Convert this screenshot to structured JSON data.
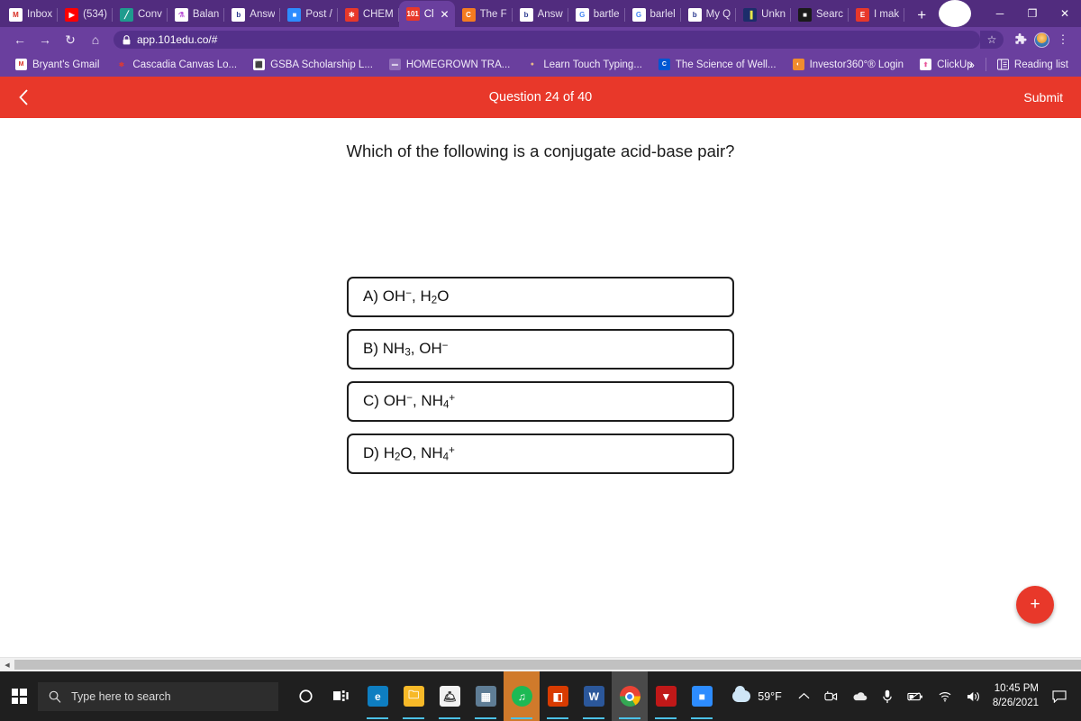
{
  "browser": {
    "tabs": [
      {
        "title": "Inbox",
        "favicon": "gmail-icon",
        "color": "#ffffff",
        "glyph": "M",
        "glyph_color": "#d93025",
        "active": false
      },
      {
        "title": "(534)",
        "favicon": "youtube-icon",
        "color": "#ff0000",
        "glyph": "▶",
        "glyph_color": "#ffffff",
        "active": false
      },
      {
        "title": "Conv",
        "favicon": "converter-icon",
        "color": "#1f9b8e",
        "glyph": "╱",
        "glyph_color": "#ffffff",
        "active": false
      },
      {
        "title": "Balan",
        "favicon": "flask-icon",
        "color": "#ffffff",
        "glyph": "⚗",
        "glyph_color": "#b84fd6",
        "active": false
      },
      {
        "title": "Answ",
        "favicon": "brainly-icon",
        "color": "#ffffff",
        "glyph": "b",
        "glyph_color": "#2b3a8f",
        "active": false
      },
      {
        "title": "Post /",
        "favicon": "zoom-icon",
        "color": "#2d8cff",
        "glyph": "■",
        "glyph_color": "#ffffff",
        "active": false
      },
      {
        "title": "CHEM",
        "favicon": "canvas-icon",
        "color": "#e8382a",
        "glyph": "✻",
        "glyph_color": "#ffffff",
        "active": false
      },
      {
        "title": "Cl",
        "favicon": "101edu-icon",
        "color": "#e8382a",
        "glyph": "101",
        "glyph_color": "#ffffff",
        "active": true
      },
      {
        "title": "The F",
        "favicon": "chegg-icon",
        "color": "#f47b20",
        "glyph": "C",
        "glyph_color": "#ffffff",
        "active": false
      },
      {
        "title": "Answ",
        "favicon": "brainly-icon",
        "color": "#ffffff",
        "glyph": "b",
        "glyph_color": "#2b3a8f",
        "active": false
      },
      {
        "title": "bartle",
        "favicon": "google-icon",
        "color": "#ffffff",
        "glyph": "G",
        "glyph_color": "#4285f4",
        "active": false
      },
      {
        "title": "barlel",
        "favicon": "google-icon",
        "color": "#ffffff",
        "glyph": "G",
        "glyph_color": "#4285f4",
        "active": false
      },
      {
        "title": "My Q",
        "favicon": "brainly-icon",
        "color": "#ffffff",
        "glyph": "b",
        "glyph_color": "#2b3a8f",
        "active": false
      },
      {
        "title": "Unkn",
        "favicon": "cylinder-icon",
        "color": "#1c2d6b",
        "glyph": "▐",
        "glyph_color": "#e8e84a",
        "active": false
      },
      {
        "title": "Searc",
        "favicon": "search-box-icon",
        "color": "#1a1a1a",
        "glyph": "■",
        "glyph_color": "#ffffff",
        "active": false
      },
      {
        "title": "I mak",
        "favicon": "excel-icon",
        "color": "#e8382a",
        "glyph": "E",
        "glyph_color": "#ffffff",
        "active": false
      }
    ],
    "new_tab_label": "+",
    "close_tab_label": "✕",
    "window_controls": {
      "minimize": "─",
      "maximize": "❐",
      "close": "✕",
      "profile_badge": "▼"
    },
    "toolbar": {
      "back": "←",
      "forward": "→",
      "reload": "↻",
      "home": "⌂",
      "lock_icon": "🔒",
      "url": "app.101edu.co/#",
      "bookmark_star": "☆",
      "extensions_icon": "🧩",
      "menu_icon": "⋮"
    },
    "bookmarks": [
      {
        "label": "Bryant's Gmail",
        "favicon": "gmail-icon",
        "color": "#ffffff",
        "glyph": "M",
        "glyph_color": "#d93025"
      },
      {
        "label": "Cascadia Canvas Lo...",
        "favicon": "canvas-icon",
        "color": "#6a3f9e",
        "glyph": "✻",
        "glyph_color": "#e8382a"
      },
      {
        "label": "GSBA Scholarship L...",
        "favicon": "gsba-icon",
        "color": "#ffffff",
        "glyph": "⬛",
        "glyph_color": "#c8102e"
      },
      {
        "label": "HOMEGROWN TRA...",
        "favicon": "generic-icon",
        "color": "#8f6cb8",
        "glyph": "▬",
        "glyph_color": "#d8ccE8"
      },
      {
        "label": "Learn Touch Typing...",
        "favicon": "typing-icon",
        "color": "#6a3f9e",
        "glyph": "●",
        "glyph_color": "#e8b98a"
      },
      {
        "label": "The Science of Well...",
        "favicon": "coursera-icon",
        "color": "#0056d2",
        "glyph": "C",
        "glyph_color": "#ffffff"
      },
      {
        "label": "Investor360°® Login",
        "favicon": "investor360-icon",
        "color": "#f08c2e",
        "glyph": "◐",
        "glyph_color": "#ffffff"
      },
      {
        "label": "ClickUp",
        "favicon": "clickup-icon",
        "color": "#ffffff",
        "glyph": "⬆",
        "glyph_color": "#e8569a"
      }
    ],
    "bookmarks_overflow": "»",
    "reading_list": {
      "label": "Reading list",
      "icon": "📖"
    }
  },
  "quiz": {
    "back_label": "‹",
    "progress_title": "Question 24 of 40",
    "submit_label": "Submit",
    "question": "Which of the following is a conjugate acid-base pair?",
    "options": [
      {
        "key": "A",
        "text": "A) OH⁻, H₂O"
      },
      {
        "key": "B",
        "text": "B) NH₃, OH⁻"
      },
      {
        "key": "C",
        "text": "C) OH⁻, NH₄⁺"
      },
      {
        "key": "D",
        "text": "D) H₂O, NH₄⁺"
      }
    ],
    "fab_label": "+",
    "header_color": "#e8382a"
  },
  "taskbar": {
    "start_label": "Start",
    "search_placeholder": "Type here to search",
    "search_icon": "🔍",
    "cortana_icon": "○",
    "taskview_icon": "⌸",
    "apps": [
      {
        "name": "edge-icon",
        "color": "#0e7ec1",
        "glyph": "e",
        "running": true
      },
      {
        "name": "file-explorer-icon",
        "color": "#f7b928",
        "glyph": "🗀",
        "running": true
      },
      {
        "name": "microsoft-store-icon",
        "color": "#f2f2f2",
        "glyph": "🛎",
        "running": true
      },
      {
        "name": "calculator-icon",
        "color": "#5f7d95",
        "glyph": "▦",
        "running": true
      },
      {
        "name": "spotify-icon",
        "color": "#1db954",
        "glyph": "♫",
        "running": true,
        "highlight": true
      },
      {
        "name": "office-icon",
        "color": "#d83b01",
        "glyph": "◧",
        "running": true
      },
      {
        "name": "word-icon",
        "color": "#2b579a",
        "glyph": "W",
        "running": true
      },
      {
        "name": "chrome-icon",
        "color": "#ffffff",
        "glyph": "●",
        "running": true,
        "highlight2": true
      },
      {
        "name": "mcafee-icon",
        "color": "#c01818",
        "glyph": "▼",
        "running": true
      },
      {
        "name": "zoom-icon",
        "color": "#2d8cff",
        "glyph": "■",
        "running": true
      }
    ],
    "tray": {
      "temperature": "59°F",
      "weather_icon": "cloud-icon",
      "overflow_icon": "ⱏ",
      "zoom_icon": "▣",
      "onedrive_icon": "☁",
      "mic_icon": "🎙",
      "battery_icon": "🔋",
      "wifi_icon": "◠",
      "volume_icon": "🔊",
      "time": "10:45 PM",
      "date": "8/26/2021",
      "notification_icon": "💬"
    }
  }
}
